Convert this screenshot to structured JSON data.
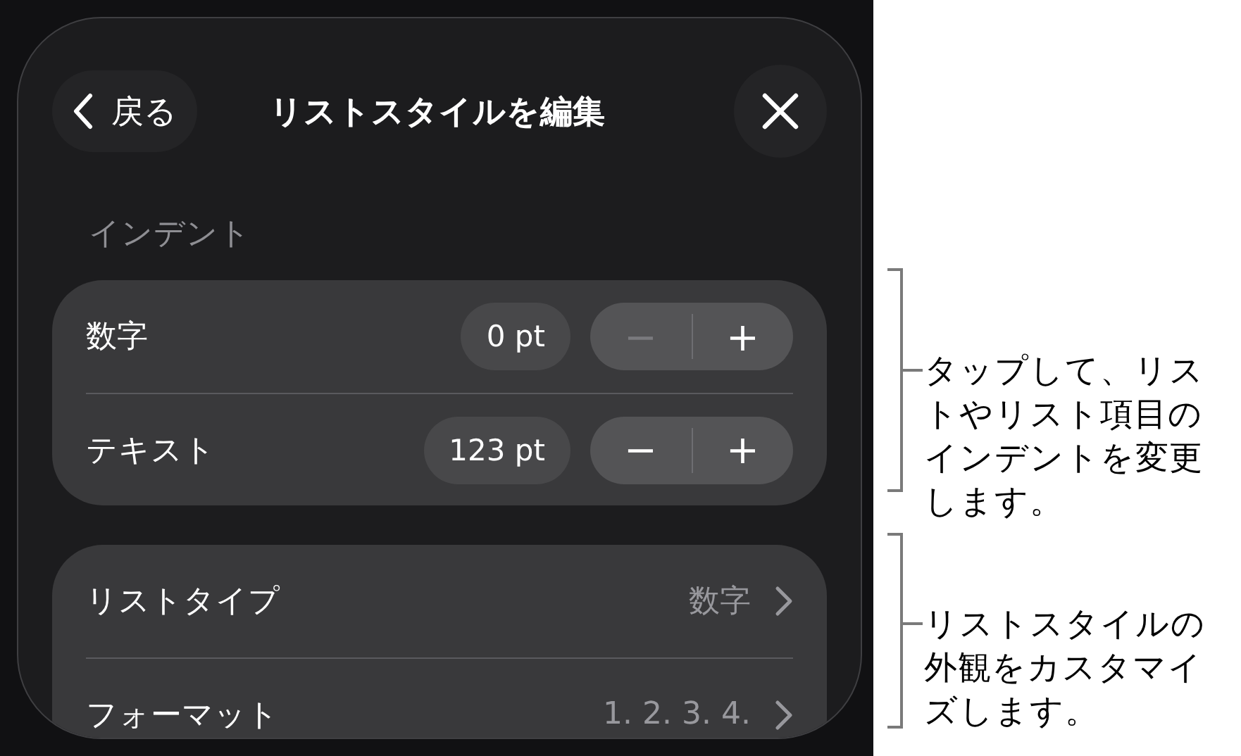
{
  "header": {
    "back": "戻る",
    "title": "リストスタイルを編集"
  },
  "indent": {
    "label": "インデント",
    "rows": [
      {
        "label": "数字",
        "value": "0 pt",
        "minus": "−",
        "plus": "+",
        "minus_disabled": true
      },
      {
        "label": "テキスト",
        "value": "123 pt",
        "minus": "−",
        "plus": "+",
        "minus_disabled": false
      }
    ]
  },
  "list_rows": [
    {
      "label": "リストタイプ",
      "value": "数字"
    },
    {
      "label": "フォーマット",
      "value": "1. 2. 3. 4."
    }
  ],
  "callouts": [
    "タップして、リストやリスト項目のインデントを変更します。",
    "リストスタイルの外観をカスタマイズします。"
  ]
}
